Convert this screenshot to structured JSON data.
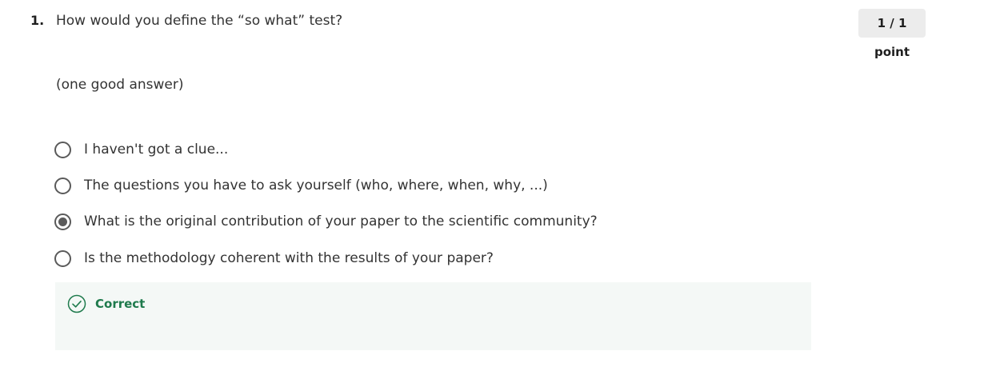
{
  "question": {
    "number": "1.",
    "prompt": "How would you define the “so what” test?",
    "hint": "(one good answer)",
    "score": "1 / 1 point"
  },
  "options": [
    {
      "label": "I haven't got a clue...",
      "selected": false
    },
    {
      "label": "The questions you have to ask yourself (who, where, when, why, ...)",
      "selected": false
    },
    {
      "label": "What is the original contribution of your paper to the scientific community?",
      "selected": true
    },
    {
      "label": "Is the methodology coherent with the results of your paper?",
      "selected": false
    }
  ],
  "feedback": {
    "status": "Correct",
    "icon": "check-circle-icon",
    "color": "#1e7a4c",
    "background": "#f4f8f6"
  }
}
